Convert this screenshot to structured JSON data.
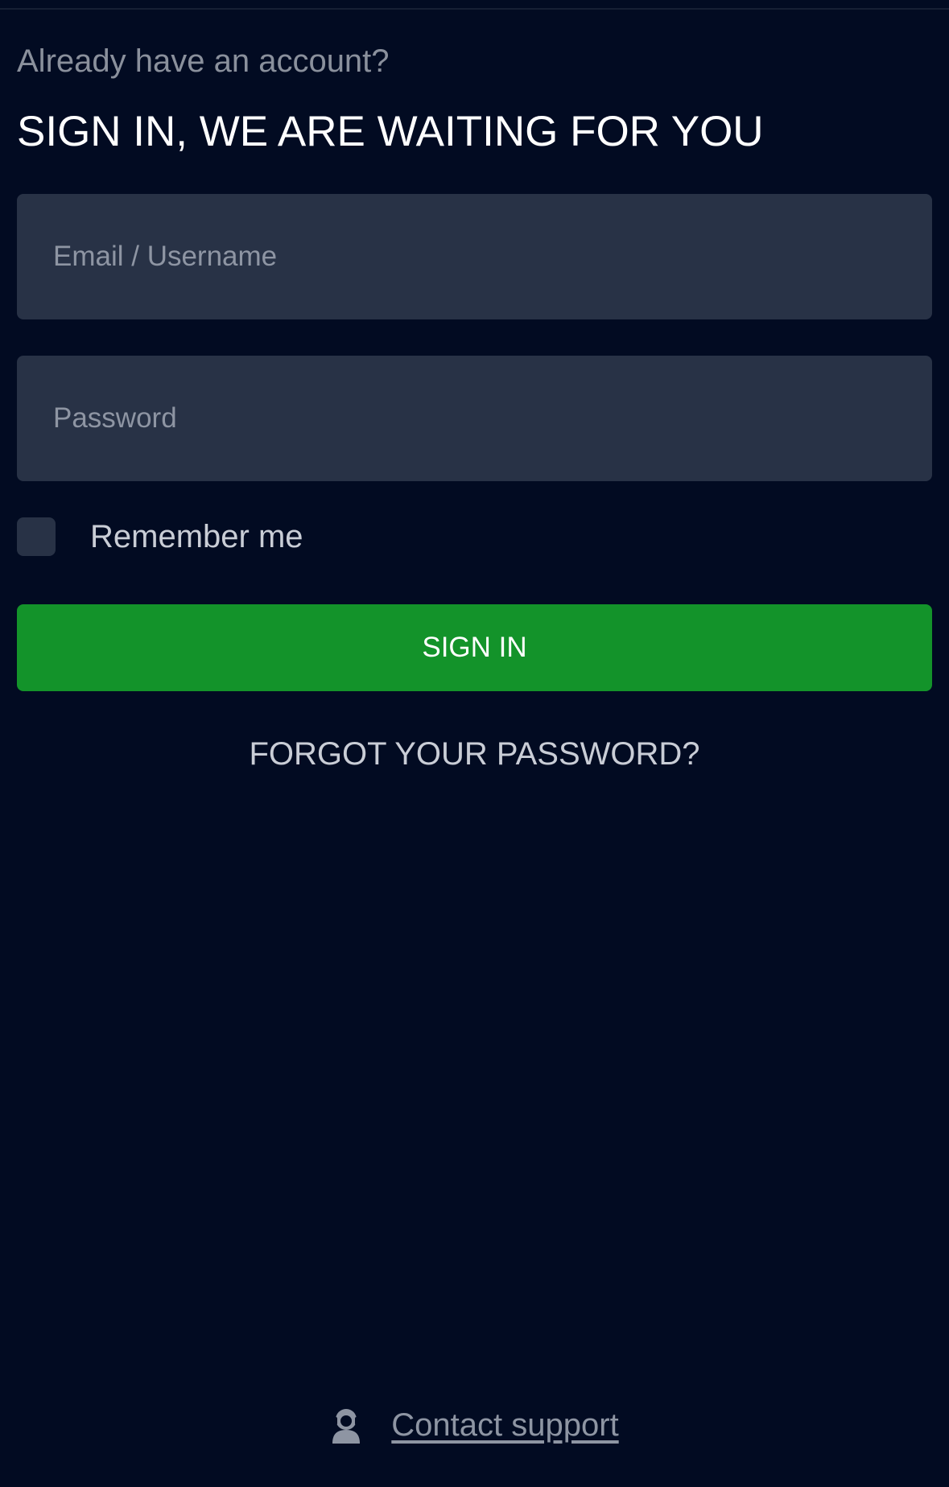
{
  "header": {
    "subtitle": "Already have an account?",
    "title": "SIGN IN, WE ARE WAITING FOR YOU"
  },
  "form": {
    "email": {
      "placeholder": "Email / Username",
      "value": ""
    },
    "password": {
      "placeholder": "Password",
      "value": ""
    },
    "remember_me": {
      "label": "Remember me",
      "checked": false
    },
    "submit_label": "SIGN IN",
    "forgot_label": "FORGOT YOUR PASSWORD?"
  },
  "footer": {
    "support_label": "Contact support",
    "support_icon": "support-agent-icon"
  },
  "colors": {
    "background": "#020b22",
    "field_background": "#283246",
    "primary_button": "#13932a"
  }
}
